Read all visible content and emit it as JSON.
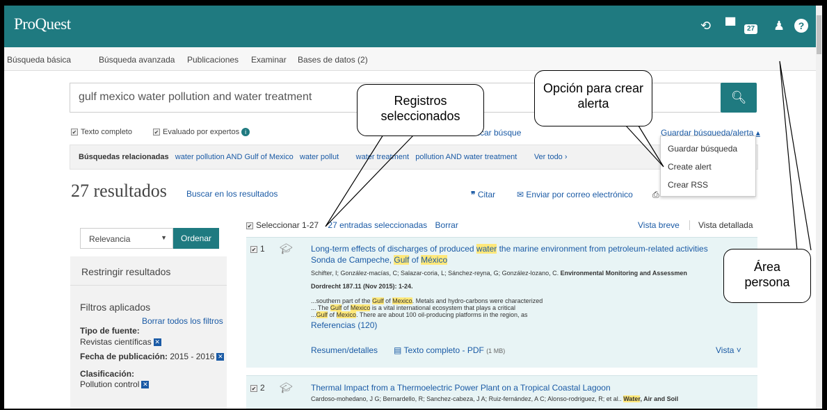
{
  "app": {
    "logo": "ProQuest",
    "folder_count": "27"
  },
  "nav": [
    "Búsqueda básica",
    "Búsqueda avanzada",
    "Publicaciones",
    "Examinar",
    "Bases de datos (2)"
  ],
  "search": {
    "query": "gulf mexico water pollution and water treatment"
  },
  "filters": {
    "full_text": "Texto completo",
    "peer": "Evaluado por expertos",
    "modify": "ficar búsque",
    "save": "Guardar búsqueda/alerta ▴"
  },
  "related": {
    "label": "Búsquedas relacionadas",
    "items": [
      "water pollution AND Gulf of Mexico",
      "water pollut",
      "water treatment",
      "pollution AND water treatment"
    ],
    "more": "Ver todo ›"
  },
  "results": {
    "count": "27 resultados",
    "within": "Buscar en los resultados",
    "cite": "Citar",
    "email": "Enviar por correo electrónico"
  },
  "dropdown": [
    "Guardar búsqueda",
    "Create alert",
    "Crear RSS"
  ],
  "sort": {
    "value": "Relevancia",
    "button": "Ordenar"
  },
  "sidebar": {
    "restrict": "Restringir resultados",
    "applied": "Filtros aplicados",
    "clear": "Borrar todos los filtros",
    "source_label": "Tipo de fuente:",
    "source": "Revistas científicas",
    "date_label": "Fecha de publicación:",
    "date": "2015 - 2016",
    "class_label": "Clasificación:",
    "class": "Pollution control"
  },
  "selection": {
    "select": "Seleccionar 1-27",
    "selected": "27 entradas seleccionadas",
    "clear": "Borrar",
    "brief": "Vista breve",
    "detail": "Vista detallada"
  },
  "records": [
    {
      "num": "1",
      "authors": "Schifter, I; González-macías, C; Salazar-coria, L; Sánchez-reyna, G; González-lozano, C.",
      "journal": "Environmental Monitoring and Assessmen",
      "pub": "Dordrecht 187.11 (Nov 2015): 1-24.",
      "refs": "Referencias (120)",
      "abstract": "Resumen/detalles",
      "pdf": "Texto completo - PDF",
      "pdf_size": "(1 MB)",
      "view": "Vista ˅"
    },
    {
      "num": "2",
      "title": "Thermal Impact from a Thermoelectric Power Plant on a Tropical Coastal Lagoon",
      "authors": "Cardoso-mohedano, J G; Bernardello, R; Sanchez-cabeza, J A; Ruiz-fernández, A C; Alonso-rodriguez, R; et al..",
      "journal": "Air and Soil"
    }
  ],
  "callouts": {
    "records": "Registros seleccionados",
    "alert": "Opción para crear alerta",
    "personal": "Área persona"
  }
}
